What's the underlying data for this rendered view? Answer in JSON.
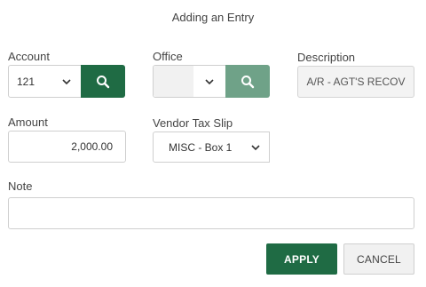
{
  "dialog": {
    "title": "Adding an Entry"
  },
  "account": {
    "label": "Account",
    "value": "121"
  },
  "office": {
    "label": "Office",
    "value": ""
  },
  "description": {
    "label": "Description",
    "value": "A/R - AGT'S RECOV"
  },
  "amount": {
    "label": "Amount",
    "value": "2,000.00"
  },
  "vendor_tax_slip": {
    "label": "Vendor Tax Slip",
    "value": "MISC - Box 1"
  },
  "note": {
    "label": "Note",
    "value": ""
  },
  "actions": {
    "apply_label": "APPLY",
    "cancel_label": "CANCEL"
  },
  "colors": {
    "primary": "#1f6b44",
    "primary_disabled": "#6fa288",
    "field_border": "#cfcfcf"
  },
  "icons": {
    "search": "search-icon",
    "dropdown": "chevron-down-icon"
  }
}
